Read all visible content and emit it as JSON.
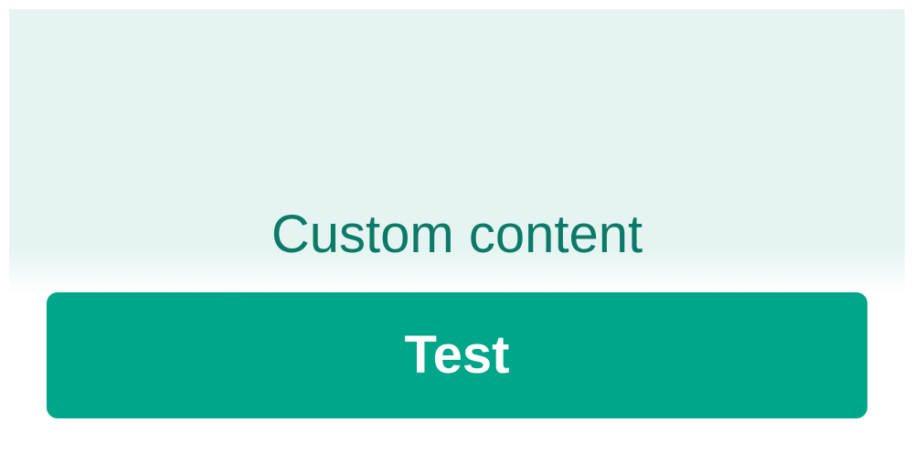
{
  "content": {
    "text": "Custom content",
    "background_color": "#e5f4f2",
    "text_color": "#0b7a66"
  },
  "button": {
    "label": "Test",
    "background_color": "#00a689",
    "text_color": "#ffffff"
  }
}
